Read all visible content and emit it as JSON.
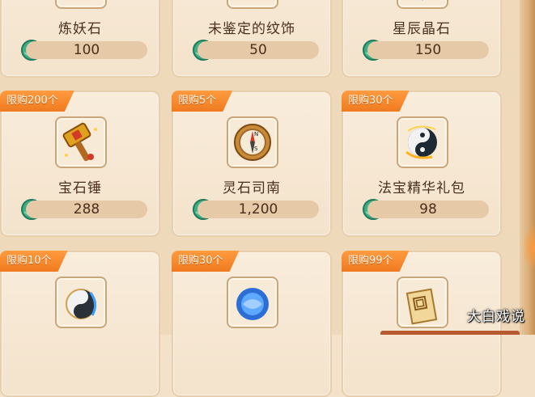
{
  "row_top": [
    {
      "name": "炼妖石",
      "price": "100",
      "icon": "refining-stone-icon"
    },
    {
      "name": "未鉴定的纹饰",
      "price": "50",
      "icon": "unidentified-pattern-icon"
    },
    {
      "name": "星辰晶石",
      "price": "150",
      "icon": "star-crystal-icon"
    }
  ],
  "row_mid": [
    {
      "limit": "限购200个",
      "name": "宝石锤",
      "price": "288",
      "icon": "gem-hammer-icon"
    },
    {
      "limit": "限购5个",
      "name": "灵石司南",
      "price": "1,200",
      "icon": "compass-icon"
    },
    {
      "limit": "限购30个",
      "name": "法宝精华礼包",
      "price": "98",
      "icon": "yin-yang-gift-icon"
    }
  ],
  "row_bottom": [
    {
      "limit": "限购10个",
      "icon": "yin-yang-orb-icon"
    },
    {
      "limit": "限购30个",
      "icon": "blue-orb-icon"
    },
    {
      "limit": "限购99个",
      "icon": "scroll-icon"
    }
  ],
  "currency_icon": "jade-coin-icon",
  "watermark": "大白戏说",
  "colors": {
    "tag": "#f07a1f",
    "text": "#4a2f1e",
    "price_bar": "#e6c9a6"
  }
}
